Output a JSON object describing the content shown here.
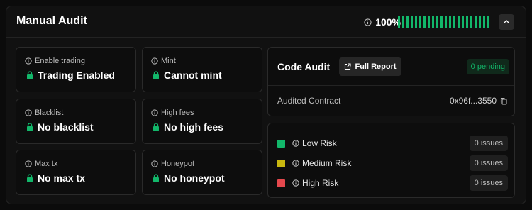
{
  "header": {
    "title": "Manual Audit",
    "score": "100%",
    "bar_count": 22,
    "progress": 1.0,
    "accent_color": "#12b76a"
  },
  "checks": [
    {
      "label": "Enable trading",
      "value": "Trading Enabled",
      "name": "enable-trading"
    },
    {
      "label": "Mint",
      "value": "Cannot mint",
      "name": "mint"
    },
    {
      "label": "Blacklist",
      "value": "No blacklist",
      "name": "blacklist"
    },
    {
      "label": "High fees",
      "value": "No high fees",
      "name": "high-fees"
    },
    {
      "label": "Max tx",
      "value": "No max tx",
      "name": "max-tx"
    },
    {
      "label": "Honeypot",
      "value": "No honeypot",
      "name": "honeypot"
    }
  ],
  "code_audit": {
    "title": "Code Audit",
    "report_label": "Full Report",
    "pending": "0 pending",
    "contract_label": "Audited Contract",
    "contract_address": "0x96f...3550"
  },
  "risks": [
    {
      "label": "Low Risk",
      "issues": "0 issues",
      "color": "#12b76a"
    },
    {
      "label": "Medium Risk",
      "issues": "0 issues",
      "color": "#c8b70f"
    },
    {
      "label": "High Risk",
      "issues": "0 issues",
      "color": "#e5484d"
    }
  ],
  "icons": {
    "info": "info-icon",
    "lock": "lock-icon",
    "external": "external-link-icon",
    "copy": "copy-icon",
    "collapse": "chevron-up-icon"
  }
}
